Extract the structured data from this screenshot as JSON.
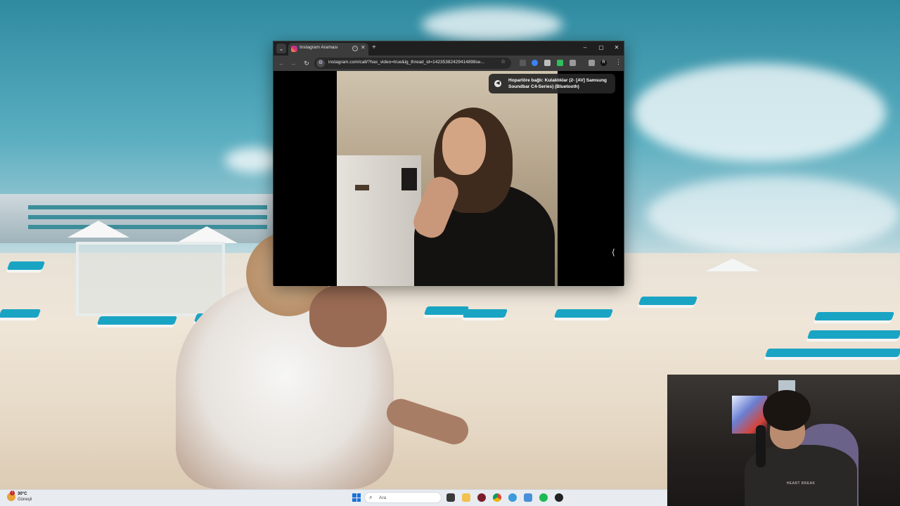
{
  "browser": {
    "tab_title": "Instagram Araması",
    "url": "instagram.com/call/?has_video=true&ig_thread_id=14235382429414898se...",
    "window_controls": {
      "minimize": "–",
      "maximize": "▢",
      "close": "✕"
    },
    "new_tab": "+",
    "tab_close": "✕",
    "nav": {
      "back": "←",
      "forward": "→",
      "reload": "↻"
    },
    "bookmark": "☆",
    "menu": "⋮",
    "profile_letter": "R"
  },
  "call": {
    "speaker_notice": "Hoparlöre bağlı: Kulaklıklar (2- [AV] Samsung Soundbar C4-Series) (Bluetooth)",
    "side_toggle": "⟨"
  },
  "taskbar": {
    "temperature": "30°C",
    "condition": "Güneşli",
    "search_placeholder": "Ara",
    "weather_alert": "!"
  },
  "webcam": {
    "shirt_text": "HEART BREAK"
  },
  "icons": {
    "instagram": "instagram-icon",
    "site_info": "site-info-icon",
    "speaker": "speaker-icon",
    "windows_start": "windows-start-icon",
    "search": "search-icon"
  },
  "colors": {
    "browser_frame": "#1f1f1f",
    "toolbar": "#3c3c3c",
    "taskbar": "#e8ebf0",
    "accent": "#1a73d8"
  }
}
